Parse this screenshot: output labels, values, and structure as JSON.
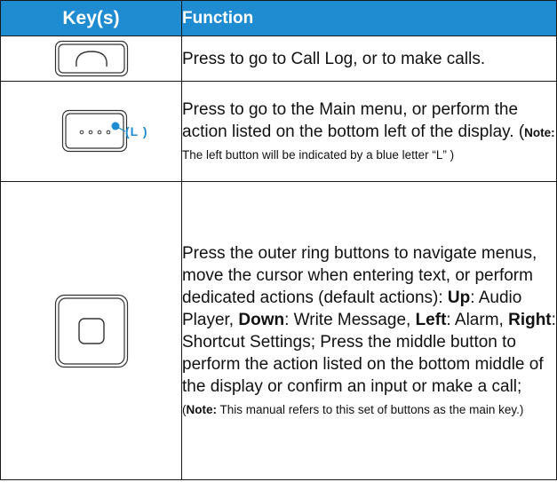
{
  "header": {
    "keys_label": "Key(s)",
    "function_label": "Function"
  },
  "rows": [
    {
      "icon": "call-key-icon",
      "text": "Press to go to Call Log, or to make calls."
    },
    {
      "icon": "left-soft-key-icon",
      "indicator_label": "(L )",
      "text": "Press to go to the Main menu, or perform the action listed on the bottom left of the display. (",
      "note_label": "Note:",
      "note_text": " The left button will be indicated by a blue letter “L” )"
    },
    {
      "icon": "main-key-icon",
      "text_a": "Press the outer ring buttons to navigate menus, move the cursor when entering text, or perform dedicated actions (default actions): ",
      "up_label": "Up",
      "up_text": ": Audio Player, ",
      "down_label": "Down",
      "down_text": ": Write Message, ",
      "left_label": "Left",
      "left_text": ": Alarm, ",
      "right_label": "Right",
      "right_text": ": Shortcut Settings; Press the middle button to perform the action listed on the bottom middle of the display or confirm an input or make a call;",
      "note_open": "(",
      "note_label": "Note:",
      "note_text": " This manual refers to this set of buttons as the main key.)"
    }
  ],
  "colors": {
    "header_bg": "#1f8bd0",
    "indicator": "#1f8bd0",
    "border": "#1a1a1a"
  }
}
